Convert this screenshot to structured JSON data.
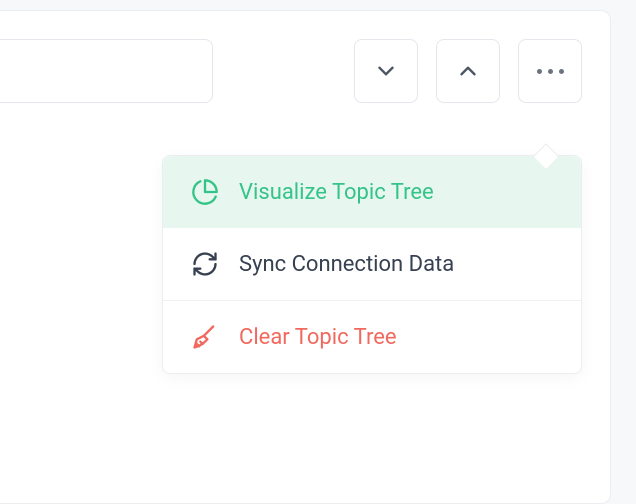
{
  "menu": {
    "items": [
      {
        "label": "Visualize Topic Tree"
      },
      {
        "label": "Sync Connection Data"
      },
      {
        "label": "Clear Topic Tree"
      }
    ]
  }
}
